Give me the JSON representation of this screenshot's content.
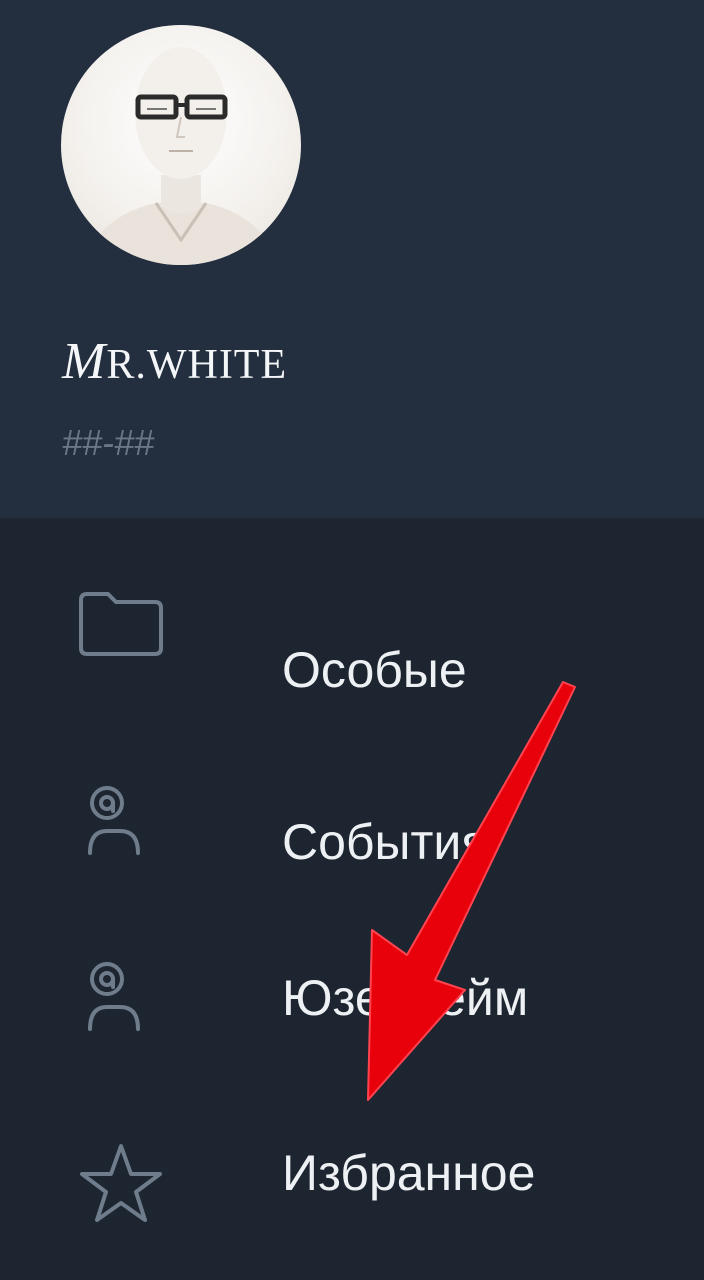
{
  "profile": {
    "name_first_letter": "M",
    "name_rest": "R.WHITE",
    "subtitle": "##-##"
  },
  "menu": {
    "items": [
      {
        "label": "Особые",
        "icon": "folder-icon"
      },
      {
        "label": "События",
        "icon": "user-at-icon"
      },
      {
        "label": "Юзернейм",
        "icon": "user-at-icon"
      },
      {
        "label": "Избранное",
        "icon": "star-icon"
      }
    ]
  },
  "colors": {
    "header_bg": "#232f3f",
    "menu_bg": "#1d2530",
    "icon_stroke": "#6f7c8b",
    "text": "#eef1f4",
    "annotation_arrow": "#e8000b"
  }
}
